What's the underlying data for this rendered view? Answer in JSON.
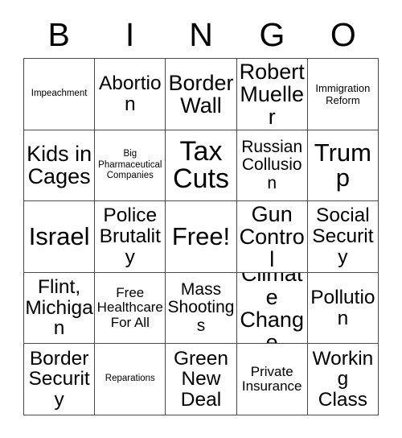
{
  "card": {
    "type": "bingo-card",
    "header_letters": [
      "B",
      "I",
      "N",
      "G",
      "O"
    ],
    "free_space_label": "Free!",
    "colors": {
      "background": "#ffffff",
      "text": "#000000",
      "grid_line": "#4a4a4a"
    },
    "grid": {
      "rows": 5,
      "columns": 5,
      "cells": [
        [
          {
            "label": "Impeachment",
            "size": "xs"
          },
          {
            "label": "Abortion",
            "size": "xl"
          },
          {
            "label": "Border\nWall",
            "size": "2xl"
          },
          {
            "label": "Robert\nMueller",
            "size": "2xl"
          },
          {
            "label": "Immigration\nReform",
            "size": "sm"
          }
        ],
        [
          {
            "label": "Kids in\nCages",
            "size": "2xl"
          },
          {
            "label": "Big\nPharmaceutical\nCompanies",
            "size": "xs"
          },
          {
            "label": "Tax\nCuts",
            "size": "4xl"
          },
          {
            "label": "Russian\nCollusion",
            "size": "lg"
          },
          {
            "label": "Trump",
            "size": "3xl"
          }
        ],
        [
          {
            "label": "Israel",
            "size": "3xl"
          },
          {
            "label": "Police\nBrutality",
            "size": "xl"
          },
          {
            "label": "Free!",
            "size": "3xl"
          },
          {
            "label": "Gun\nControl",
            "size": "2xl"
          },
          {
            "label": "Social\nSecurity",
            "size": "xl"
          }
        ],
        [
          {
            "label": "Flint,\nMichigan",
            "size": "xl"
          },
          {
            "label": "Free\nHealthcare\nFor All",
            "size": "md"
          },
          {
            "label": "Mass\nShootings",
            "size": "lg"
          },
          {
            "label": "Climate\nChange",
            "size": "2xl"
          },
          {
            "label": "Pollution",
            "size": "xl"
          }
        ],
        [
          {
            "label": "Border\nSecurity",
            "size": "xl"
          },
          {
            "label": "Reparations",
            "size": "xs"
          },
          {
            "label": "Green\nNew\nDeal",
            "size": "xl"
          },
          {
            "label": "Private\nInsurance",
            "size": "md"
          },
          {
            "label": "Working\nClass",
            "size": "xl"
          }
        ]
      ]
    }
  }
}
